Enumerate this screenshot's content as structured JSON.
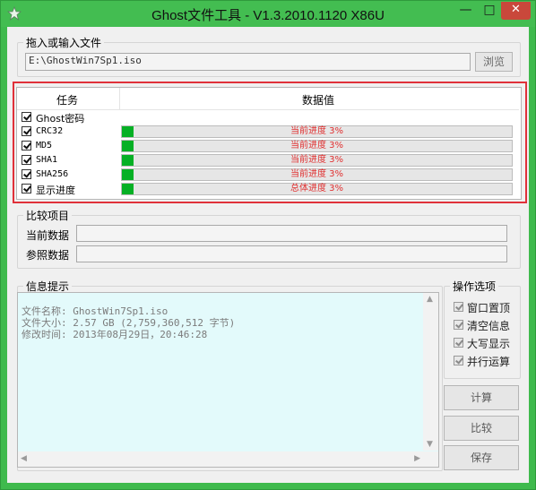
{
  "window": {
    "title": "Ghost文件工具 - V1.3.2010.1120 X86U",
    "min_label": "—",
    "max_label": "□",
    "close_label": "✕"
  },
  "file_input": {
    "label": "拖入或输入文件",
    "value": "E:\\GhostWin7Sp1.iso",
    "browse_label": "浏览"
  },
  "task_list": {
    "col_task": "任务",
    "col_value": "数据值",
    "rows": [
      {
        "label": "Ghost密码",
        "checked": true,
        "progress_text": "",
        "progress": 0
      },
      {
        "label": "CRC32",
        "checked": true,
        "progress_text": "当前进度 3%",
        "progress": 0.03
      },
      {
        "label": "MD5",
        "checked": true,
        "progress_text": "当前进度 3%",
        "progress": 0.03
      },
      {
        "label": "SHA1",
        "checked": true,
        "progress_text": "当前进度 3%",
        "progress": 0.03
      },
      {
        "label": "SHA256",
        "checked": true,
        "progress_text": "当前进度 3%",
        "progress": 0.03
      },
      {
        "label": "显示进度",
        "checked": true,
        "progress_text": "总体进度 3%",
        "progress": 0.03
      }
    ]
  },
  "compare": {
    "label": "比较项目",
    "current_label": "当前数据",
    "reference_label": "参照数据",
    "current_value": "",
    "reference_value": ""
  },
  "info": {
    "label": "信息提示",
    "lines": [
      "文件名称: GhostWin7Sp1.iso",
      "文件大小: 2.57 GB (2,759,360,512 字节)",
      "修改时间: 2013年08月29日，20:46:28"
    ]
  },
  "options": {
    "label": "操作选项",
    "items": [
      {
        "label": "窗口置顶",
        "checked": true
      },
      {
        "label": "清空信息",
        "checked": true
      },
      {
        "label": "大写显示",
        "checked": true
      },
      {
        "label": "并行运算",
        "checked": true
      }
    ]
  },
  "actions": {
    "compute": "计算",
    "compare": "比较",
    "save": "保存"
  },
  "colors": {
    "titlebar": "#43bd51",
    "progress_fill": "#06b025",
    "progress_text": "#e03030",
    "highlight": "#e0313a",
    "info_bg": "#e3fafb"
  }
}
